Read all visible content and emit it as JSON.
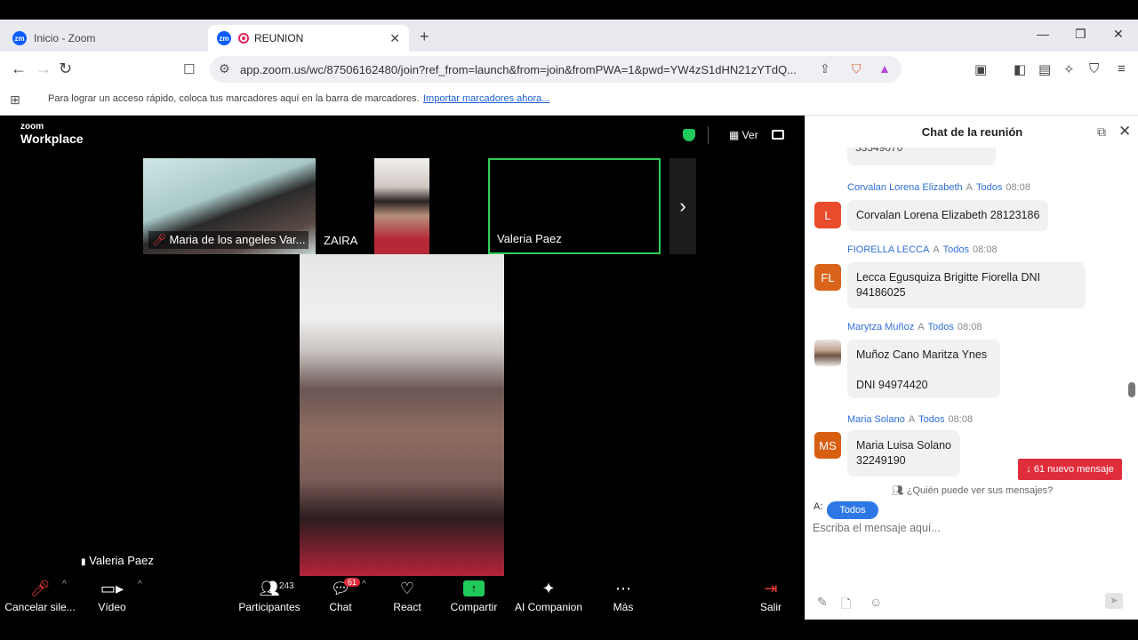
{
  "browser": {
    "tabs": [
      {
        "label": "Inicio - Zoom",
        "icon": "zoom-icon"
      },
      {
        "label": "REUNION",
        "icon": "zoom-icon"
      }
    ],
    "url": "app.zoom.us/wc/87506162480/join?ref_from=launch&from=join&fromPWA=1&pwd=YW4zS1dHN21zYTdQ...",
    "bookmarks_hint": "Para lograr un acceso rápido, coloca tus marcadores aquí en la barra de marcadores.",
    "bookmarks_link": "Importar marcadores ahora..."
  },
  "meeting": {
    "logo_small": "zoom",
    "logo_big": "Workplace",
    "view_label": "Ver",
    "thumbnails": [
      {
        "name": "Maria de los angeles Var...",
        "muted": true
      },
      {
        "name": "ZAIRA",
        "muted": false
      },
      {
        "name": "Valeria Paez",
        "muted": false,
        "active": true
      }
    ],
    "active_speaker": "Valeria Paez",
    "controls": {
      "mic": "Cancelar sile...",
      "video": "Vídeo",
      "participants": "Participantes",
      "participants_count": "243",
      "chat": "Chat",
      "chat_badge": "61",
      "react": "React",
      "share": "Compartir",
      "companion": "AI Companion",
      "more": "Más",
      "leave": "Salir"
    }
  },
  "chat": {
    "title": "Chat de la reunión",
    "partial_text": "33349070",
    "messages": [
      {
        "sender": "Corvalan Lorena Elizabeth",
        "to": "A",
        "recipient": "Todos",
        "time": "08:08",
        "initials": "L",
        "text": "Corvalan Lorena Elizabeth 28123186"
      },
      {
        "sender": "FIORELLA LECCA",
        "to": "A",
        "recipient": "Todos",
        "time": "08:08",
        "initials": "FL",
        "text_line1": "Lecca Egusquiza Brigitte Fiorella DNI",
        "text_line2": "94186025"
      },
      {
        "sender": "Marytza Muñoz",
        "to": "A",
        "recipient": "Todos",
        "time": "08:08",
        "initials": "",
        "text_line1": "Muñoz Cano Maritza Ynes",
        "text_line2": "DNI 94974420"
      },
      {
        "sender": "Maria Solano",
        "to": "A",
        "recipient": "Todos",
        "time": "08:08",
        "initials": "MS",
        "text_line1": "Maria Luisa Solano",
        "text_line2": "32249190"
      }
    ],
    "new_messages": "↓ 61 nuevo mensaje",
    "who_can_see": "¿Quién puede ver sus mensajes?",
    "to_label": "A:",
    "recipient_button": "Todos",
    "input_placeholder": "Escriba el mensaje aquí..."
  }
}
